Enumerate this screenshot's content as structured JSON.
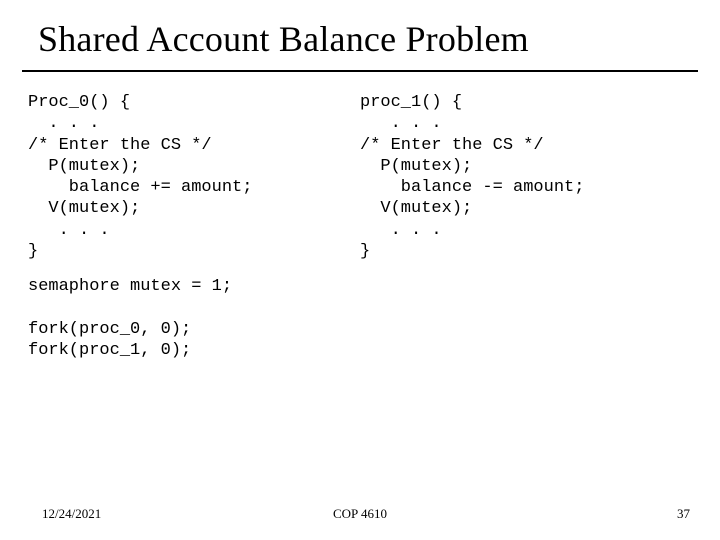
{
  "title": "Shared Account Balance Problem",
  "code": {
    "proc0": "Proc_0() {\n  . . .\n/* Enter the CS */\n  P(mutex);\n    balance += amount;\n  V(mutex);\n   . . .\n}",
    "proc1": "proc_1() {\n   . . .\n/* Enter the CS */\n  P(mutex);\n    balance -= amount;\n  V(mutex);\n   . . .\n}",
    "below": "semaphore mutex = 1;\n\nfork(proc_0, 0);\nfork(proc_1, 0);"
  },
  "footer": {
    "date": "12/24/2021",
    "course": "COP 4610",
    "page": "37"
  }
}
